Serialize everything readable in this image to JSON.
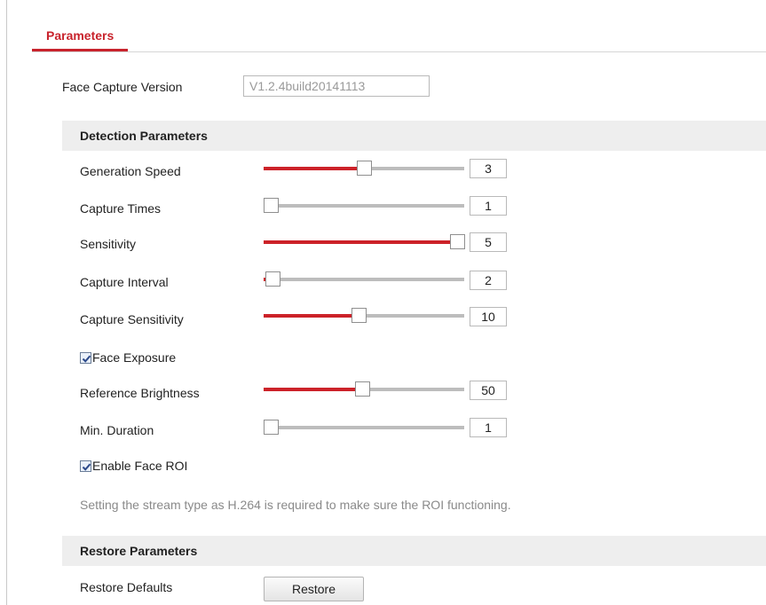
{
  "tabs": [
    {
      "label": "Parameters",
      "active": true
    }
  ],
  "version": {
    "label": "Face Capture Version",
    "value": "V1.2.4build20141113"
  },
  "detection": {
    "title": "Detection Parameters",
    "generation_speed": {
      "label": "Generation Speed",
      "value": "3",
      "level": 0.5
    },
    "capture_times": {
      "label": "Capture Times",
      "value": "1",
      "level": 0.0
    },
    "sensitivity": {
      "label": "Sensitivity",
      "value": "5",
      "level": 1.0
    },
    "capture_interval": {
      "label": "Capture Interval",
      "value": "2",
      "level": 0.01
    },
    "capture_sensitivity": {
      "label": "Capture Sensitivity",
      "value": "10",
      "level": 0.47
    },
    "face_exposure": {
      "label": "Face Exposure",
      "checked": true
    },
    "reference_brightness": {
      "label": "Reference Brightness",
      "value": "50",
      "level": 0.49
    },
    "min_duration": {
      "label": "Min. Duration",
      "value": "1",
      "level": 0.0
    },
    "enable_face_roi": {
      "label": "Enable Face ROI",
      "checked": true
    },
    "roi_note": "Setting the stream type as H.264 is required to make sure the ROI functioning."
  },
  "restore": {
    "title": "Restore Parameters",
    "label": "Restore Defaults",
    "button": "Restore"
  },
  "colors": {
    "accent": "#cc2229",
    "track": "#bdbdbd",
    "section_bg": "#eeeeee",
    "note_text": "#8a8a8a"
  }
}
